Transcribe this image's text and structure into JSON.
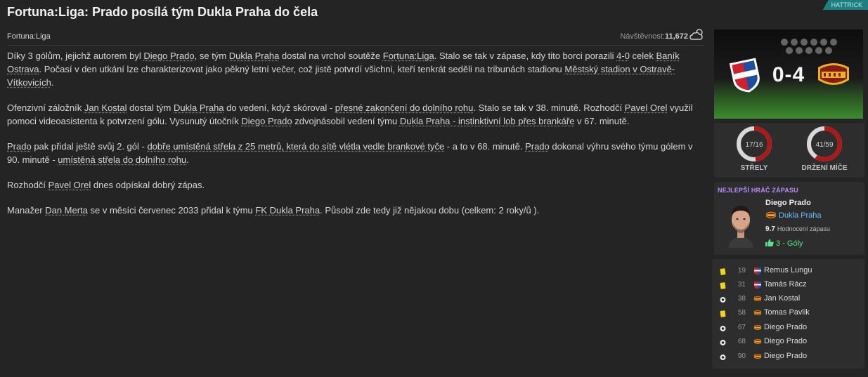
{
  "headline": "Fortuna:Liga: Prado posílá tým Dukla Praha do čela",
  "badge": "HATTRICK",
  "meta": {
    "league": "Fortuna:Liga",
    "attendance_label": "Návštěvnost:",
    "attendance_value": "11,672"
  },
  "article": {
    "p1": {
      "t1": "Díky 3 gólům, jejichž autorem byl ",
      "l1": "Diego Prado",
      "t2": ", se tým ",
      "l2": "Dukla Praha",
      "t3": " dostal na vrchol soutěže ",
      "l3": "Fortuna:Liga",
      "t4": ". Stalo se tak v zápase, kdy tito borci porazili ",
      "l4": "4-0",
      "t5": " celek ",
      "l5": "Baník Ostrava",
      "t6": ". Počasí v den utkání lze charakterizovat jako pěkný letní večer, což jistě potvrdí všichni, kteří tenkrát seděli na tribunách stadionu ",
      "l6": "Městský stadion v Ostravě-Vítkovicích",
      "t7": "."
    },
    "p2": {
      "t1": "Ofenzivní záložník ",
      "l1": "Jan Kostal",
      "t2": " dostal tým ",
      "l2": "Dukla Praha",
      "t3": " do vedení, když skóroval - ",
      "l3": "přesné zakončení do dolního rohu",
      "t4": ". Stalo se tak v 38. minutě. Rozhodčí ",
      "l4": "Pavel Orel",
      "t5": " využil pomoci videoasistenta k potvrzení gólu. Vysunutý útočník ",
      "l5": "Diego Prado",
      "t6": " zdvojnásobil vedení týmu ",
      "l6": "Dukla Praha - instinktivní lob přes brankáře",
      "t7": " v 67. minutě."
    },
    "p3": {
      "l1": "Prado",
      "t1": " pak přidal ještě svůj 2. gól - ",
      "l2": "dobře umístěná střela z 25 metrů, která do sítě vlétla vedle brankové tyče",
      "t2": " - a to v 68. minutě. ",
      "l3": "Prado",
      "t3": " dokonal výhru svého týmu gólem v 90. minutě - ",
      "l4": "umístěná střela do dolního rohu",
      "t4": "."
    },
    "p4": {
      "t1": "Rozhodčí ",
      "l1": "Pavel Orel",
      "t2": " dnes odpískal dobrý zápas."
    },
    "p5": {
      "t1": "Manažer ",
      "l1": "Dan Merta",
      "t2": " se v měsíci červenec 2033 přidal k týmu ",
      "l2": "FK Dukla Praha",
      "t3": ". Působí zde tedy již nějakou dobu (celkem: 2 roky/ů )."
    }
  },
  "score": {
    "text": "0-4",
    "home": 0,
    "away": 4
  },
  "stats": {
    "shots": {
      "value": "17/16",
      "label": "STŘELY",
      "home": 17,
      "away": 16,
      "color_home": "#d8d8d8",
      "color_away": "#b01818"
    },
    "possession": {
      "value": "41/59",
      "label": "DRŽENÍ MÍČE",
      "home": 41,
      "away": 59,
      "color_home": "#d8d8d8",
      "color_away": "#b01818"
    }
  },
  "motm": {
    "title": "NEJLEPŠÍ HRÁČ ZÁPASU",
    "name": "Diego Prado",
    "team": "Dukla Praha",
    "rating_value": "9.7",
    "rating_label": "Hodnocení zápasu",
    "goals": "3 - Góly"
  },
  "events": [
    {
      "type": "yellow-card",
      "icon": "yellow-card-icon",
      "minute": "19",
      "team": "home",
      "player": "Remus Lungu"
    },
    {
      "type": "yellow-card",
      "icon": "yellow-card-icon",
      "minute": "31",
      "team": "home",
      "player": "Tamás Rácz"
    },
    {
      "type": "goal",
      "icon": "ball-icon",
      "minute": "38",
      "team": "away",
      "player": "Jan Kostal"
    },
    {
      "type": "yellow-card",
      "icon": "yellow-card-icon",
      "minute": "58",
      "team": "away",
      "player": "Tomas Pavlik"
    },
    {
      "type": "goal",
      "icon": "ball-icon",
      "minute": "67",
      "team": "away",
      "player": "Diego Prado"
    },
    {
      "type": "goal",
      "icon": "ball-icon",
      "minute": "68",
      "team": "away",
      "player": "Diego Prado"
    },
    {
      "type": "goal",
      "icon": "ball-icon",
      "minute": "90",
      "team": "away",
      "player": "Diego Prado"
    }
  ],
  "colors": {
    "background": "#242424",
    "card": "#2d2d2d",
    "accent_red": "#b01818",
    "motm_purple": "#b58cff",
    "team_blue": "#66c3ff",
    "goals_green": "#57e28b",
    "badge_teal": "#1d7f7f"
  }
}
